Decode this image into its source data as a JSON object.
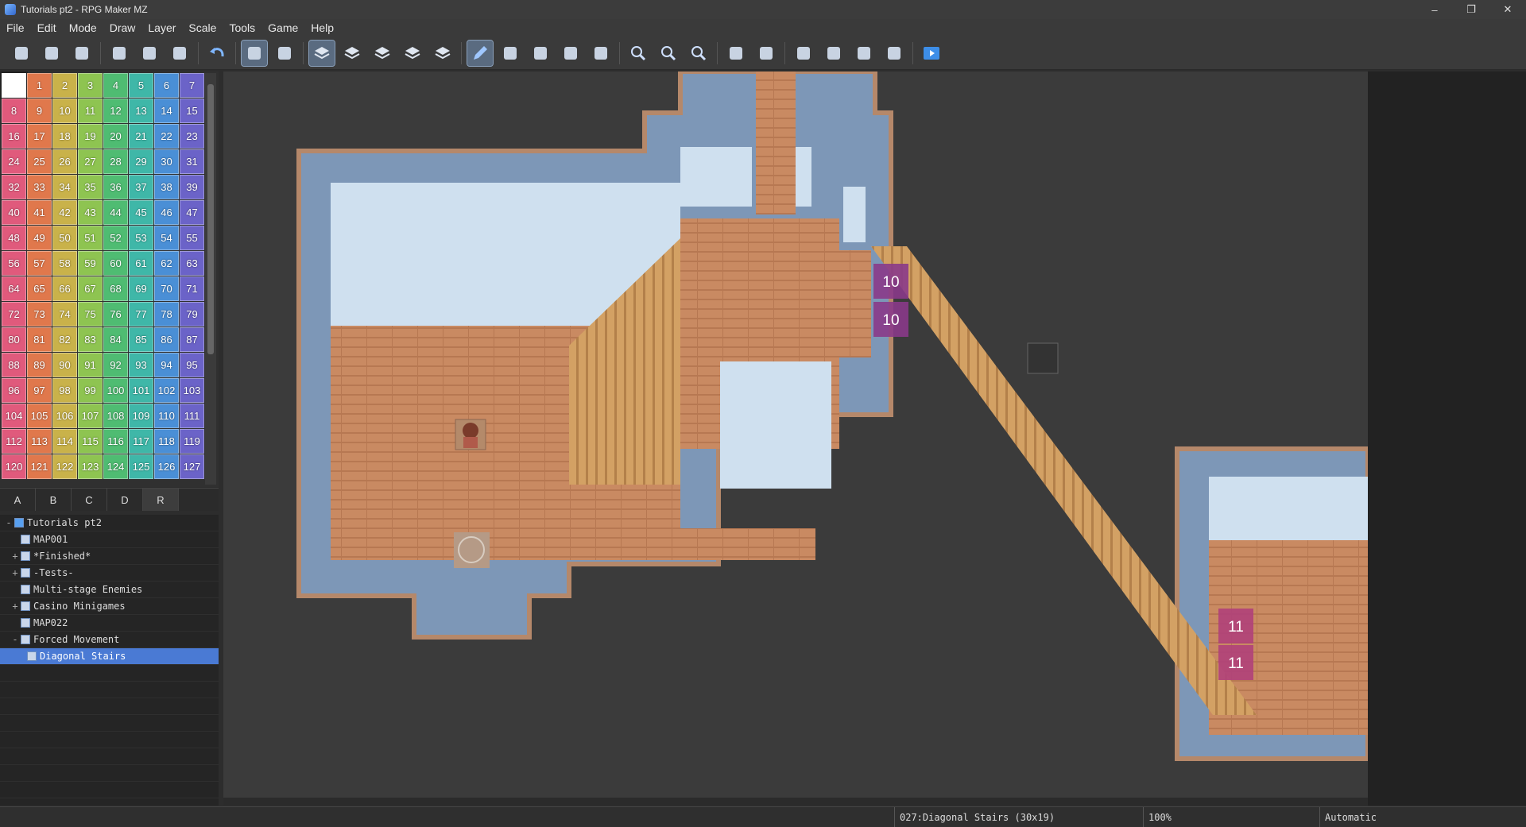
{
  "window": {
    "title": "Tutorials pt2 - RPG Maker MZ",
    "minimize": "–",
    "restore": "❐",
    "close": "✕"
  },
  "menu": [
    "File",
    "Edit",
    "Mode",
    "Draw",
    "Layer",
    "Scale",
    "Tools",
    "Game",
    "Help"
  ],
  "toolbar": [
    {
      "name": "new-project-icon"
    },
    {
      "name": "open-project-icon"
    },
    {
      "name": "save-project-icon"
    },
    {
      "sep": true
    },
    {
      "name": "cut-icon"
    },
    {
      "name": "copy-icon"
    },
    {
      "name": "paste-icon"
    },
    {
      "sep": true
    },
    {
      "name": "undo-icon"
    },
    {
      "sep": true
    },
    {
      "name": "map-mode-icon",
      "active": true
    },
    {
      "name": "event-mode-icon"
    },
    {
      "sep": true
    },
    {
      "name": "layer-auto-icon",
      "active": true
    },
    {
      "name": "layer-1-icon"
    },
    {
      "name": "layer-2-icon"
    },
    {
      "name": "layer-3-icon"
    },
    {
      "name": "layer-4-icon"
    },
    {
      "sep": true
    },
    {
      "name": "pencil-icon",
      "active": true
    },
    {
      "name": "rectangle-icon"
    },
    {
      "name": "ellipse-icon"
    },
    {
      "name": "fill-icon"
    },
    {
      "name": "shadow-pen-icon"
    },
    {
      "sep": true
    },
    {
      "name": "zoom-in-icon"
    },
    {
      "name": "zoom-out-icon"
    },
    {
      "name": "zoom-actual-icon"
    },
    {
      "sep": true
    },
    {
      "name": "database-icon"
    },
    {
      "name": "plugin-manager-icon"
    },
    {
      "sep": true
    },
    {
      "name": "sound-test-icon"
    },
    {
      "name": "event-searcher-icon"
    },
    {
      "name": "resource-manager-icon"
    },
    {
      "name": "character-generator-icon"
    },
    {
      "sep": true
    },
    {
      "name": "playtest-icon"
    }
  ],
  "palette": {
    "selected": 0,
    "colors": [
      "#e05a7c",
      "#e0784c",
      "#c9b24a",
      "#8ec451",
      "#4fbc72",
      "#3fb7a8",
      "#4a8fd6",
      "#6b63c8"
    ],
    "tiles": [
      "",
      "1",
      "2",
      "3",
      "4",
      "5",
      "6",
      "7",
      "8",
      "9",
      "10",
      "11",
      "12",
      "13",
      "14",
      "15",
      "16",
      "17",
      "18",
      "19",
      "20",
      "21",
      "22",
      "23",
      "24",
      "25",
      "26",
      "27",
      "28",
      "29",
      "30",
      "31",
      "32",
      "33",
      "34",
      "35",
      "36",
      "37",
      "38",
      "39",
      "40",
      "41",
      "42",
      "43",
      "44",
      "45",
      "46",
      "47",
      "48",
      "49",
      "50",
      "51",
      "52",
      "53",
      "54",
      "55",
      "56",
      "57",
      "58",
      "59",
      "60",
      "61",
      "62",
      "63",
      "64",
      "65",
      "66",
      "67",
      "68",
      "69",
      "70",
      "71",
      "72",
      "73",
      "74",
      "75",
      "76",
      "77",
      "78",
      "79",
      "80",
      "81",
      "82",
      "83",
      "84",
      "85",
      "86",
      "87",
      "88",
      "89",
      "90",
      "91",
      "92",
      "93",
      "94",
      "95",
      "96",
      "97",
      "98",
      "99",
      "100",
      "101",
      "102",
      "103",
      "104",
      "105",
      "106",
      "107",
      "108",
      "109",
      "110",
      "111",
      "112",
      "113",
      "114",
      "115",
      "116",
      "117",
      "118",
      "119",
      "120",
      "121",
      "122",
      "123",
      "124",
      "125",
      "126",
      "127"
    ]
  },
  "tabs": [
    {
      "label": "A"
    },
    {
      "label": "B"
    },
    {
      "label": "C"
    },
    {
      "label": "D"
    },
    {
      "label": "R",
      "active": true
    }
  ],
  "tree": [
    {
      "label": "Tutorials pt2",
      "expander": "-",
      "indent": 0,
      "project": true
    },
    {
      "label": "MAP001",
      "expander": "",
      "indent": 1
    },
    {
      "label": "*Finished*",
      "expander": "+",
      "indent": 1
    },
    {
      "label": "-Tests-",
      "expander": "+",
      "indent": 1
    },
    {
      "label": "Multi-stage Enemies",
      "expander": "",
      "indent": 1
    },
    {
      "label": "Casino Minigames",
      "expander": "+",
      "indent": 1
    },
    {
      "label": "MAP022",
      "expander": "",
      "indent": 1
    },
    {
      "label": "Forced Movement",
      "expander": "-",
      "indent": 1
    },
    {
      "label": "Diagonal Stairs",
      "expander": "",
      "indent": 2,
      "selected": true
    }
  ],
  "map": {
    "events": [
      {
        "label": "10",
        "color": "#8a3a8a"
      },
      {
        "label": "10",
        "color": "#8a3a8a"
      },
      {
        "label": "11",
        "color": "#b0407a"
      },
      {
        "label": "11",
        "color": "#b0407a"
      }
    ]
  },
  "status": {
    "map": "027:Diagonal Stairs (30x19)",
    "zoom": "100%",
    "mode": "Automatic"
  }
}
